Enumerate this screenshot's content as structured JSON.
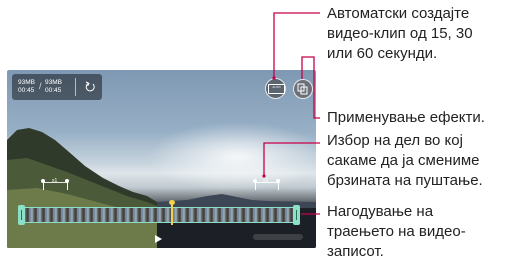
{
  "player": {
    "size_current": "93MB",
    "time_current": "00:45",
    "size_total": "93MB",
    "time_total": "00:45",
    "slash": "/",
    "auto_button_text": "AUTO",
    "speed_left": "x1",
    "speed_right": "x1"
  },
  "callouts": {
    "auto": [
      "Автоматски создајте",
      "видео-клип од 15, 30",
      "или 60 секунди."
    ],
    "effects": [
      "Применување ефекти."
    ],
    "speed": [
      "Избор на дел во кој",
      "сакаме да ја смениме",
      "брзината на пуштање."
    ],
    "duration": [
      "Нагодување на",
      "траењето на видео-",
      "записот."
    ]
  },
  "icons": [
    "undo-icon",
    "auto-clip-icon",
    "effects-icon",
    "play-icon"
  ],
  "colors": {
    "callout_line": "#c8004a",
    "timeline_frame": "#8be0c7",
    "playhead": "#f2d24b"
  }
}
